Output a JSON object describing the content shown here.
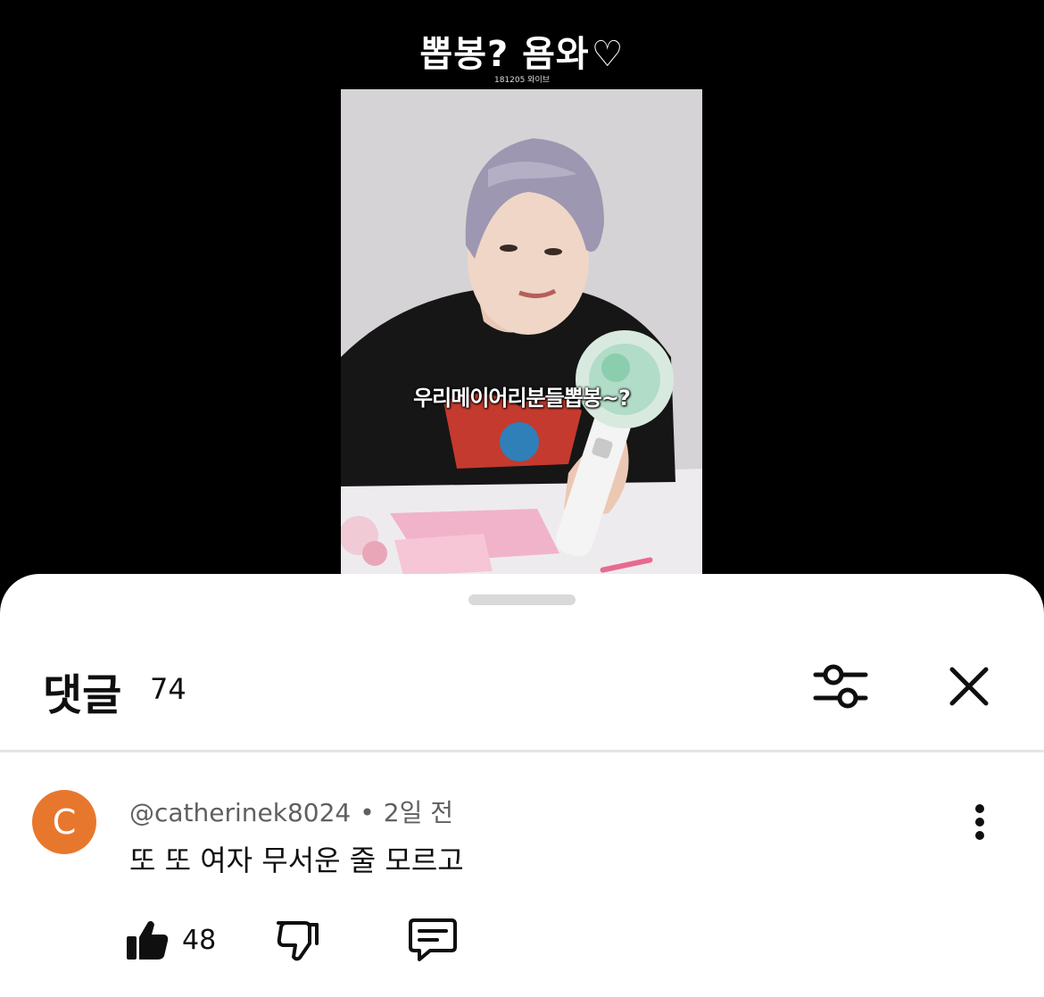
{
  "video": {
    "title": "뽑봉? 욤와",
    "heart": "♡",
    "subtitle": "181205 와이브",
    "caption": "우리메이어리분들뽑봉~?"
  },
  "sheet": {
    "title": "댓글",
    "count": "74"
  },
  "comment": {
    "avatar_letter": "C",
    "avatar_color": "#e8772e",
    "author": "@catherinek8024",
    "separator": "•",
    "time": "2일 전",
    "text": "또 또 여자 무서운 줄 모르고",
    "like_count": "48"
  },
  "icons": {
    "filter": "sliders-icon",
    "close": "close-icon",
    "more": "more-vertical-icon",
    "like": "thumbs-up-icon",
    "dislike": "thumbs-down-icon",
    "reply": "comment-icon"
  }
}
